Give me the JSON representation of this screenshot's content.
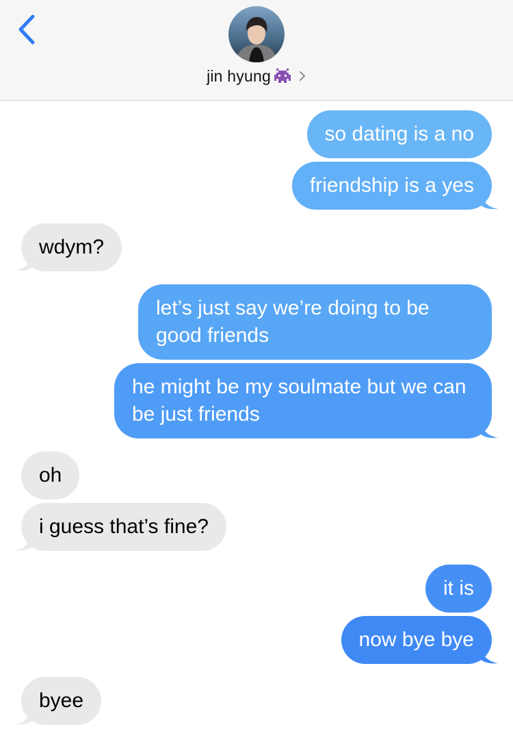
{
  "header": {
    "contact_name": "jin hyung",
    "emoji_icon": "alien-monster-icon",
    "back_icon": "chevron-left-icon",
    "details_icon": "chevron-right-icon"
  },
  "colors": {
    "sent_top": "#66b5f7",
    "sent_bottom": "#3d88f5",
    "received": "#e9e9eb",
    "accent": "#2f7cf6"
  },
  "messages": [
    {
      "from": "me",
      "text": "so dating is a no"
    },
    {
      "from": "me",
      "text": "friendship is a yes"
    },
    {
      "from": "them",
      "text": "wdym?"
    },
    {
      "from": "me",
      "text": "let’s just say we’re doing to be good friends"
    },
    {
      "from": "me",
      "text": "he might be my soulmate but we can be just friends"
    },
    {
      "from": "them",
      "text": "oh"
    },
    {
      "from": "them",
      "text": "i guess that’s fine?"
    },
    {
      "from": "me",
      "text": "it is"
    },
    {
      "from": "me",
      "text": "now bye bye"
    },
    {
      "from": "them",
      "text": "byee"
    }
  ]
}
